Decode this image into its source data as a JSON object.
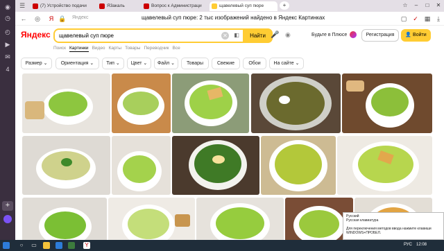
{
  "browser": {
    "tabs": [
      {
        "label": "(7) Устройство подачи",
        "fav_color": "#c00"
      },
      {
        "label": "Я3акаль",
        "fav_color": "#c00"
      },
      {
        "label": "Вопрос к Администраци",
        "fav_color": "#c00"
      },
      {
        "label": "щавелевый суп пюре",
        "fav_color": "#fc3"
      }
    ],
    "new_tab_icon": "plus-icon",
    "address": {
      "domain": "Яндекс",
      "title": "щавелевый суп пюре: 2 тыс изображений найдено в Яндекс Картинках"
    }
  },
  "header": {
    "logo_main": "Яндекс",
    "search_value": "щавелевый суп пюре",
    "search_button": "Найти",
    "plus_link": "Будьте в Плюсе",
    "register_button": "Регистрация",
    "login_button": "Войти"
  },
  "services": [
    {
      "label": "Поиск",
      "active": false
    },
    {
      "label": "Картинки",
      "active": true
    },
    {
      "label": "Видео",
      "active": false
    },
    {
      "label": "Карты",
      "active": false
    },
    {
      "label": "Товары",
      "active": false
    },
    {
      "label": "Переводчик",
      "active": false
    },
    {
      "label": "Все",
      "active": false
    }
  ],
  "filters": [
    {
      "label": "Размер ⌄"
    },
    {
      "label": "Ориентация ⌄"
    },
    {
      "label": "Тип ⌄"
    },
    {
      "label": "Цвет ⌄"
    },
    {
      "label": "Файл ⌄"
    },
    {
      "label": "Товары"
    },
    {
      "label": "Свежие"
    },
    {
      "label": "Обои"
    },
    {
      "label": "На сайте ⌄"
    }
  ],
  "taskbar": {
    "lang": "РУС",
    "time": "12:08"
  },
  "tooltip": {
    "line1": "Русский",
    "line2": "Русская клавиатура",
    "line3": "Для переключения методов ввода нажмите клавиши",
    "line4": "WINDOWS+ПРОБЕЛ."
  },
  "colors": {
    "accent": "#ffcc33",
    "soup": "#8dc63f",
    "sidebar": "#3a2f3f",
    "taskbar": "#1f2d3a"
  }
}
